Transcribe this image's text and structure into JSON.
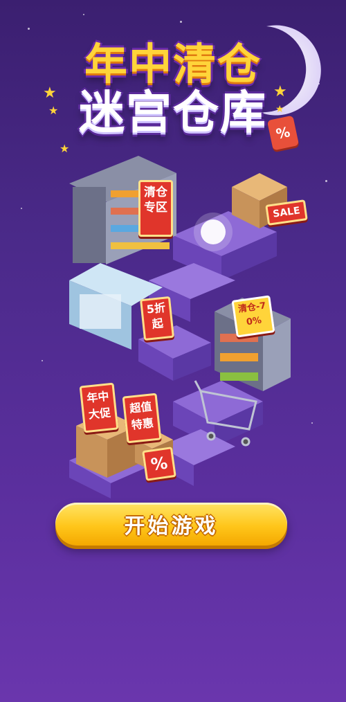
{
  "title": {
    "line1": "年中清仓",
    "line2": "迷宫仓库"
  },
  "tags": {
    "percent_tag": "%"
  },
  "scene": {
    "sign_clearance_zone": "清仓专区",
    "sign_sale": "SALE",
    "sign_discount": "5折起",
    "sign_clearance_70": "清仓-70%",
    "sign_mid_year_promo": "年中大促",
    "sign_great_value": "超值特惠",
    "sign_percent": "%"
  },
  "start_button": {
    "label": "开始游戏"
  },
  "colors": {
    "bg_top": "#3b1f70",
    "bg_bottom": "#6a36ad",
    "button": "#ffc61a",
    "title_yellow": "#ffd43a",
    "sign_red": "#e0352b"
  }
}
